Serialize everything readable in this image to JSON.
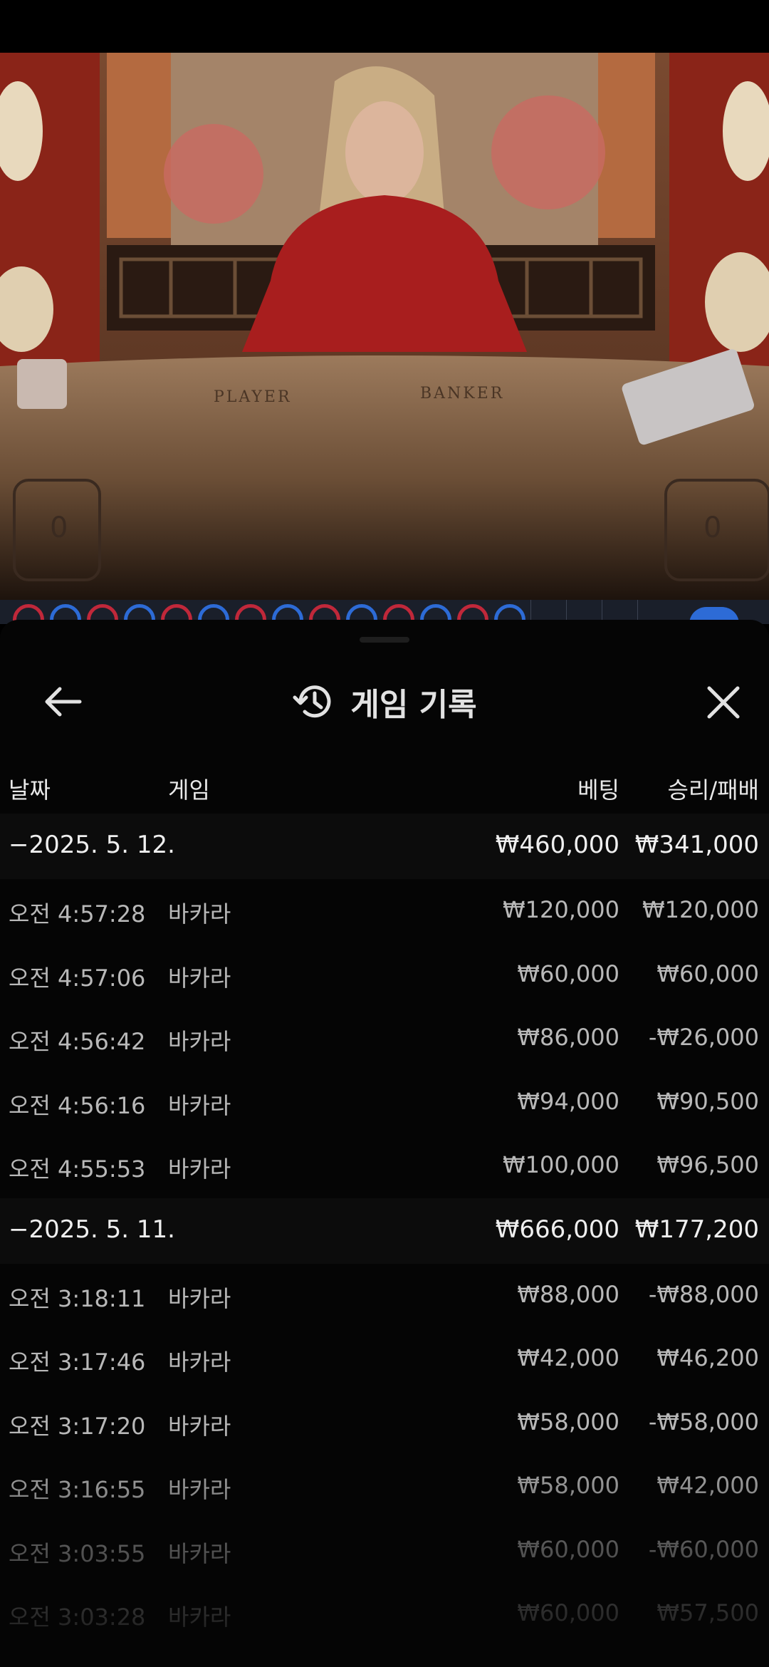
{
  "header": {
    "title": "게임 기록",
    "back_icon": "arrow-left-icon",
    "history_icon": "history-icon",
    "close_icon": "close-icon"
  },
  "table": {
    "columns": {
      "date": "날짜",
      "game": "게임",
      "bet": "베팅",
      "winloss": "승리/패배"
    },
    "rows": [
      {
        "type": "group",
        "date": "−2025. 5. 12.",
        "game": "",
        "bet": "₩460,000",
        "winloss": "₩341,000"
      },
      {
        "type": "item",
        "date": "오전 4:57:28",
        "game": "바카라",
        "bet": "₩120,000",
        "winloss": "₩120,000"
      },
      {
        "type": "item",
        "date": "오전 4:57:06",
        "game": "바카라",
        "bet": "₩60,000",
        "winloss": "₩60,000"
      },
      {
        "type": "item",
        "date": "오전 4:56:42",
        "game": "바카라",
        "bet": "₩86,000",
        "winloss": "-₩26,000"
      },
      {
        "type": "item",
        "date": "오전 4:56:16",
        "game": "바카라",
        "bet": "₩94,000",
        "winloss": "₩90,500"
      },
      {
        "type": "item",
        "date": "오전 4:55:53",
        "game": "바카라",
        "bet": "₩100,000",
        "winloss": "₩96,500"
      },
      {
        "type": "group",
        "date": "−2025. 5. 11.",
        "game": "",
        "bet": "₩666,000",
        "winloss": "₩177,200"
      },
      {
        "type": "item",
        "date": "오전 3:18:11",
        "game": "바카라",
        "bet": "₩88,000",
        "winloss": "-₩88,000"
      },
      {
        "type": "item",
        "date": "오전 3:17:46",
        "game": "바카라",
        "bet": "₩42,000",
        "winloss": "₩46,200"
      },
      {
        "type": "item",
        "date": "오전 3:17:20",
        "game": "바카라",
        "bet": "₩58,000",
        "winloss": "-₩58,000"
      },
      {
        "type": "item",
        "date": "오전 3:16:55",
        "game": "바카라",
        "bet": "₩58,000",
        "winloss": "₩42,000"
      },
      {
        "type": "item",
        "date": "오전 3:03:55",
        "game": "바카라",
        "bet": "₩60,000",
        "winloss": "-₩60,000"
      },
      {
        "type": "item",
        "date": "오전 3:03:28",
        "game": "바카라",
        "bet": "₩60,000",
        "winloss": "₩57,500"
      }
    ]
  },
  "video": {
    "table_label_player": "PLAYER",
    "table_label_banker": "BANKER",
    "counter_left": "0",
    "counter_right": "0"
  },
  "colors": {
    "panel_bg": "#050505",
    "group_row_bg": "#0c0c0c",
    "text_primary": "#e6e6e6",
    "text_secondary": "#b8b8b8",
    "player_red": "#c0283a",
    "banker_blue": "#2d6bd6"
  }
}
